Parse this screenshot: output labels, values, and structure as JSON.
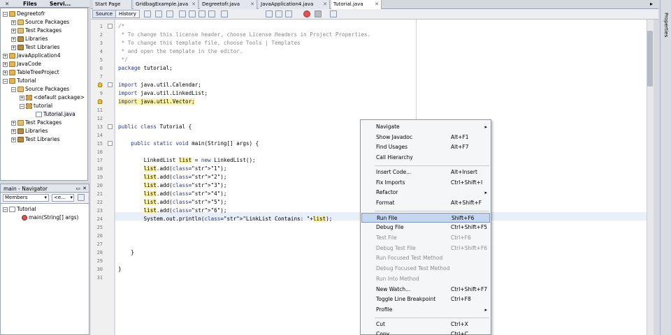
{
  "left_tabs": [
    "Files",
    "Servi..."
  ],
  "project_tree": [
    {
      "label": "Degreetofr",
      "depth": 0,
      "expanded": true,
      "icon": "project-icon"
    },
    {
      "label": "Source Packages",
      "depth": 1,
      "expanded": false,
      "icon": "source-packages-icon"
    },
    {
      "label": "Test Packages",
      "depth": 1,
      "expanded": false,
      "icon": "test-packages-icon"
    },
    {
      "label": "Libraries",
      "depth": 1,
      "expanded": false,
      "icon": "libraries-icon"
    },
    {
      "label": "Test Libraries",
      "depth": 1,
      "expanded": false,
      "icon": "libraries-icon"
    },
    {
      "label": "JavaApplication4",
      "depth": 0,
      "expanded": false,
      "icon": "project-icon"
    },
    {
      "label": "JavaCode",
      "depth": 0,
      "expanded": false,
      "icon": "project-icon"
    },
    {
      "label": "TableTreeProject",
      "depth": 0,
      "expanded": false,
      "icon": "project-icon"
    },
    {
      "label": "Tutorial",
      "depth": 0,
      "expanded": true,
      "icon": "project-icon"
    },
    {
      "label": "Source Packages",
      "depth": 1,
      "expanded": true,
      "icon": "source-packages-icon"
    },
    {
      "label": "<default package>",
      "depth": 2,
      "expanded": false,
      "icon": "package-icon"
    },
    {
      "label": "tutorial",
      "depth": 2,
      "expanded": true,
      "icon": "package-icon"
    },
    {
      "label": "Tutorial.java",
      "depth": 3,
      "expanded": null,
      "icon": "java-file-icon"
    },
    {
      "label": "Test Packages",
      "depth": 1,
      "expanded": false,
      "icon": "test-packages-icon"
    },
    {
      "label": "Libraries",
      "depth": 1,
      "expanded": false,
      "icon": "libraries-icon"
    },
    {
      "label": "Test Libraries",
      "depth": 1,
      "expanded": false,
      "icon": "libraries-icon"
    }
  ],
  "navigator": {
    "title": "main - Navigator",
    "filter_members": "Members",
    "filter_other": "<e...",
    "tree": [
      {
        "label": "Tutorial",
        "depth": 0
      },
      {
        "label": "main(String[] args)",
        "depth": 1
      }
    ]
  },
  "editor_tabs": [
    {
      "label": "Start Page",
      "active": false
    },
    {
      "label": "GridbagExample.java",
      "active": false
    },
    {
      "label": "Degreetofr.java",
      "active": false
    },
    {
      "label": "JavaApplication4.java",
      "active": false
    },
    {
      "label": "Tutorial.java",
      "active": true
    }
  ],
  "editor_toolbar": {
    "source": "Source",
    "history": "History"
  },
  "code_lines": [
    {
      "n": "1",
      "t": "/*"
    },
    {
      "n": "2",
      "t": " * To change this license header, choose License Headers in Project Properties."
    },
    {
      "n": "3",
      "t": " * To change this template file, choose Tools | Templates"
    },
    {
      "n": "4",
      "t": " * and open the template in the editor."
    },
    {
      "n": "5",
      "t": " */"
    },
    {
      "n": "6",
      "t": "package tutorial;"
    },
    {
      "n": "7",
      "t": ""
    },
    {
      "n": "8",
      "t": "import java.util.Calendar;"
    },
    {
      "n": "9",
      "t": "import java.util.LinkedList;"
    },
    {
      "n": "10",
      "t": "import java.util.Vector;"
    },
    {
      "n": "11",
      "t": ""
    },
    {
      "n": "12",
      "t": ""
    },
    {
      "n": "13",
      "t": "public class Tutorial {"
    },
    {
      "n": "14",
      "t": ""
    },
    {
      "n": "15",
      "t": "    public static void main(String[] args) {"
    },
    {
      "n": "16",
      "t": ""
    },
    {
      "n": "17",
      "t": "        LinkedList list = new LinkedList();"
    },
    {
      "n": "18",
      "t": "        list.add(\"1\");"
    },
    {
      "n": "19",
      "t": "        list.add(\"2\");"
    },
    {
      "n": "20",
      "t": "        list.add(\"3\");"
    },
    {
      "n": "21",
      "t": "        list.add(\"4\");"
    },
    {
      "n": "22",
      "t": "        list.add(\"5\");"
    },
    {
      "n": "23",
      "t": "        list.add(\"6\");"
    },
    {
      "n": "24",
      "t": "        System.out.println(\"LinkList Contains: \"+list);"
    },
    {
      "n": "25",
      "t": ""
    },
    {
      "n": "26",
      "t": ""
    },
    {
      "n": "27",
      "t": ""
    },
    {
      "n": "28",
      "t": "    }"
    },
    {
      "n": "29",
      "t": ""
    },
    {
      "n": "30",
      "t": "}"
    },
    {
      "n": "31",
      "t": ""
    }
  ],
  "context_menu": [
    {
      "label": "Navigate",
      "shortcut": "",
      "submenu": true,
      "disabled": false
    },
    {
      "label": "Show Javadoc",
      "shortcut": "Alt+F1",
      "submenu": false,
      "disabled": false
    },
    {
      "label": "Find Usages",
      "shortcut": "Alt+F7",
      "submenu": false,
      "disabled": false
    },
    {
      "label": "Call Hierarchy",
      "shortcut": "",
      "submenu": false,
      "disabled": false
    },
    {
      "sep": true
    },
    {
      "label": "Insert Code...",
      "shortcut": "Alt+Insert",
      "submenu": false,
      "disabled": false
    },
    {
      "label": "Fix Imports",
      "shortcut": "Ctrl+Shift+I",
      "submenu": false,
      "disabled": false
    },
    {
      "label": "Refactor",
      "shortcut": "",
      "submenu": true,
      "disabled": false
    },
    {
      "label": "Format",
      "shortcut": "Alt+Shift+F",
      "submenu": false,
      "disabled": false
    },
    {
      "sep": true
    },
    {
      "label": "Run File",
      "shortcut": "Shift+F6",
      "submenu": false,
      "disabled": false,
      "highlighted": true
    },
    {
      "label": "Debug File",
      "shortcut": "Ctrl+Shift+F5",
      "submenu": false,
      "disabled": false
    },
    {
      "label": "Test File",
      "shortcut": "Ctrl+F6",
      "submenu": false,
      "disabled": true
    },
    {
      "label": "Debug Test File",
      "shortcut": "Ctrl+Shift+F6",
      "submenu": false,
      "disabled": true
    },
    {
      "label": "Run Focused Test Method",
      "shortcut": "",
      "submenu": false,
      "disabled": true
    },
    {
      "label": "Debug Focused Test Method",
      "shortcut": "",
      "submenu": false,
      "disabled": true
    },
    {
      "label": "Run Into Method",
      "shortcut": "",
      "submenu": false,
      "disabled": true
    },
    {
      "label": "New Watch...",
      "shortcut": "Ctrl+Shift+F7",
      "submenu": false,
      "disabled": false
    },
    {
      "label": "Toggle Line Breakpoint",
      "shortcut": "Ctrl+F8",
      "submenu": false,
      "disabled": false
    },
    {
      "label": "Profile",
      "shortcut": "",
      "submenu": true,
      "disabled": false
    },
    {
      "sep": true
    },
    {
      "label": "Cut",
      "shortcut": "Ctrl+X",
      "submenu": false,
      "disabled": false
    },
    {
      "label": "Copy",
      "shortcut": "Ctrl+C",
      "submenu": false,
      "disabled": false
    }
  ],
  "right_panel": {
    "label": "Properties"
  }
}
